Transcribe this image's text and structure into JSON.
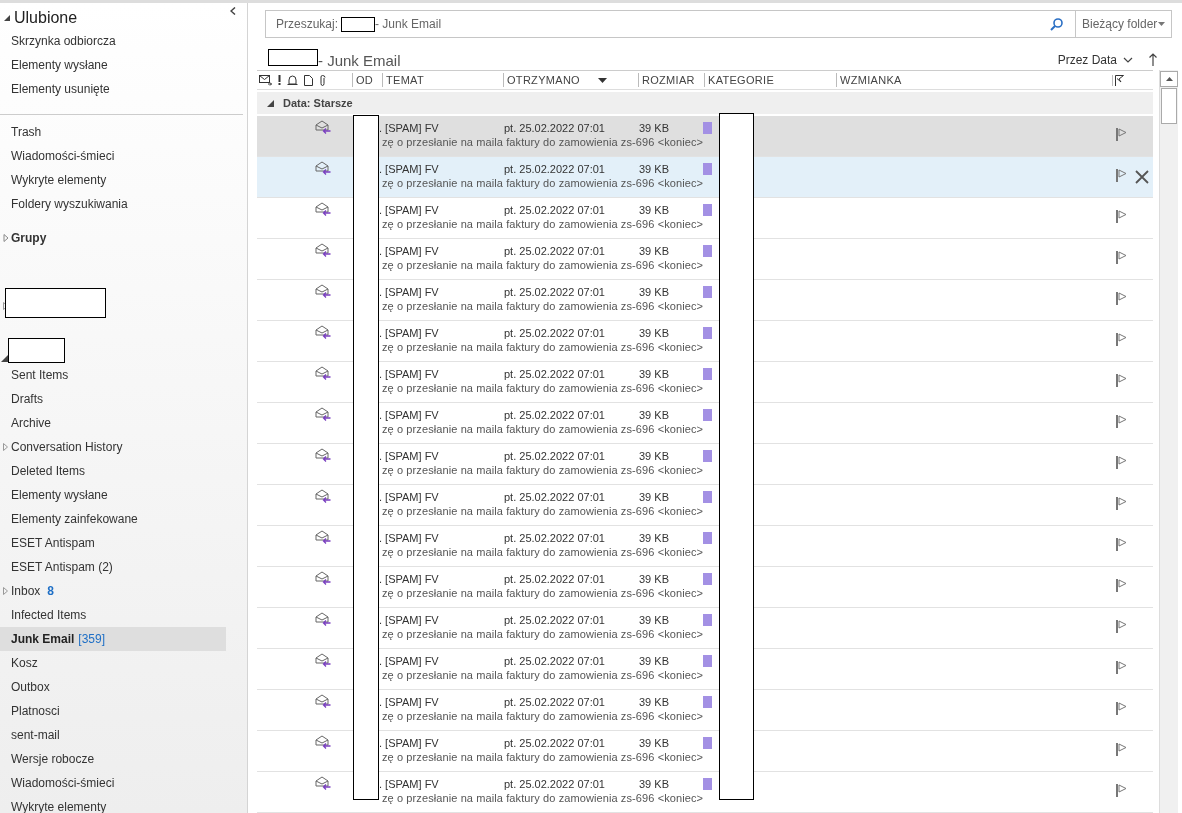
{
  "sidebar": {
    "favorites": {
      "title": "Ulubione",
      "expanded": true,
      "items": [
        {
          "label": "Skrzynka odbiorcza"
        },
        {
          "label": "Elementy wysłane"
        },
        {
          "label": "Elementy usunięte"
        }
      ]
    },
    "folders": [
      {
        "label": "Trash"
      },
      {
        "label": "Wiadomości-śmieci"
      },
      {
        "label": "Wykryte elementy"
      },
      {
        "label": "Foldery wyszukiwania"
      }
    ],
    "groups": {
      "label": "Grupy",
      "expanded": false
    },
    "accounts": [
      {
        "expanded": false
      },
      {
        "expanded": true,
        "folders": [
          {
            "label": "Sent Items",
            "selected": false
          },
          {
            "label": "Drafts",
            "selected": false
          },
          {
            "label": "Archive",
            "selected": false
          },
          {
            "label": "Conversation History",
            "selected": false,
            "expanded": false
          },
          {
            "label": "Deleted Items",
            "selected": false
          },
          {
            "label": "Elementy wysłane",
            "selected": false
          },
          {
            "label": "Elementy zainfekowane",
            "selected": false
          },
          {
            "label": "ESET Antispam",
            "selected": false
          },
          {
            "label": "ESET Antispam (2)",
            "selected": false
          },
          {
            "label": "Inbox",
            "selected": false,
            "expanded": false,
            "count": "8",
            "kind": "unread"
          },
          {
            "label": "Infected Items",
            "selected": false
          },
          {
            "label": "Junk Email",
            "selected": true,
            "count": "[359]",
            "kind": "total"
          },
          {
            "label": "Kosz",
            "selected": false
          },
          {
            "label": "Outbox",
            "selected": false
          },
          {
            "label": "Platnosci",
            "selected": false
          },
          {
            "label": "sent-mail",
            "selected": false
          },
          {
            "label": "Wersje robocze",
            "selected": false
          },
          {
            "label": "Wiadomości-śmieci",
            "selected": false
          },
          {
            "label": "Wykryte elementy",
            "selected": false
          }
        ]
      }
    ]
  },
  "search": {
    "prefix": "Przeszukaj:",
    "suffix": "- Junk Email",
    "scope": "Bieżący folder"
  },
  "folder_title": "- Junk Email",
  "sort": {
    "label": "Przez Data"
  },
  "columns": [
    "OD",
    "TEMAT",
    "OTRZYMANO",
    "ROZMIAR",
    "KATEGORIE",
    "WZMIANKA"
  ],
  "group": {
    "label": "Data: Starsze",
    "expanded": true
  },
  "messages": [
    {
      "subject": ". [SPAM] FV",
      "preview": "zę o przesłanie na maila faktury do zamowienia zs-696 <koniec>",
      "received": "pt. 25.02.2022 07:01",
      "size": "39 KB",
      "color": "#a390e4",
      "selected": true,
      "hover": false
    },
    {
      "subject": ". [SPAM] FV",
      "preview": "zę o przesłanie na maila faktury do zamowienia zs-696 <koniec>",
      "received": "pt. 25.02.2022 07:01",
      "size": "39 KB",
      "color": "#a390e4",
      "selected": false,
      "hover": true
    },
    {
      "subject": ". [SPAM] FV",
      "preview": "zę o przesłanie na maila faktury do zamowienia zs-696 <koniec>",
      "received": "pt. 25.02.2022 07:01",
      "size": "39 KB",
      "color": "#a390e4",
      "selected": false,
      "hover": false
    },
    {
      "subject": ". [SPAM] FV",
      "preview": "zę o przesłanie na maila faktury do zamowienia zs-696 <koniec>",
      "received": "pt. 25.02.2022 07:01",
      "size": "39 KB",
      "color": "#a390e4",
      "selected": false,
      "hover": false
    },
    {
      "subject": ". [SPAM] FV",
      "preview": "zę o przesłanie na maila faktury do zamowienia zs-696 <koniec>",
      "received": "pt. 25.02.2022 07:01",
      "size": "39 KB",
      "color": "#a390e4",
      "selected": false,
      "hover": false
    },
    {
      "subject": ". [SPAM] FV",
      "preview": "zę o przesłanie na maila faktury do zamowienia zs-696 <koniec>",
      "received": "pt. 25.02.2022 07:01",
      "size": "39 KB",
      "color": "#a390e4",
      "selected": false,
      "hover": false
    },
    {
      "subject": ". [SPAM] FV",
      "preview": "zę o przesłanie na maila faktury do zamowienia zs-696 <koniec>",
      "received": "pt. 25.02.2022 07:01",
      "size": "39 KB",
      "color": "#a390e4",
      "selected": false,
      "hover": false
    },
    {
      "subject": ". [SPAM] FV",
      "preview": "zę o przesłanie na maila faktury do zamowienia zs-696 <koniec>",
      "received": "pt. 25.02.2022 07:01",
      "size": "39 KB",
      "color": "#a390e4",
      "selected": false,
      "hover": false
    },
    {
      "subject": ". [SPAM] FV",
      "preview": "zę o przesłanie na maila faktury do zamowienia zs-696 <koniec>",
      "received": "pt. 25.02.2022 07:01",
      "size": "39 KB",
      "color": "#a390e4",
      "selected": false,
      "hover": false
    },
    {
      "subject": ". [SPAM] FV",
      "preview": "zę o przesłanie na maila faktury do zamowienia zs-696 <koniec>",
      "received": "pt. 25.02.2022 07:01",
      "size": "39 KB",
      "color": "#a390e4",
      "selected": false,
      "hover": false
    },
    {
      "subject": ". [SPAM] FV",
      "preview": "zę o przesłanie na maila faktury do zamowienia zs-696 <koniec>",
      "received": "pt. 25.02.2022 07:01",
      "size": "39 KB",
      "color": "#a390e4",
      "selected": false,
      "hover": false
    },
    {
      "subject": ". [SPAM] FV",
      "preview": "zę o przesłanie na maila faktury do zamowienia zs-696 <koniec>",
      "received": "pt. 25.02.2022 07:01",
      "size": "39 KB",
      "color": "#a390e4",
      "selected": false,
      "hover": false
    },
    {
      "subject": ". [SPAM] FV",
      "preview": "zę o przesłanie na maila faktury do zamowienia zs-696 <koniec>",
      "received": "pt. 25.02.2022 07:01",
      "size": "39 KB",
      "color": "#a390e4",
      "selected": false,
      "hover": false
    },
    {
      "subject": ". [SPAM] FV",
      "preview": "zę o przesłanie na maila faktury do zamowienia zs-696 <koniec>",
      "received": "pt. 25.02.2022 07:01",
      "size": "39 KB",
      "color": "#a390e4",
      "selected": false,
      "hover": false
    },
    {
      "subject": ". [SPAM] FV",
      "preview": "zę o przesłanie na maila faktury do zamowienia zs-696 <koniec>",
      "received": "pt. 25.02.2022 07:01",
      "size": "39 KB",
      "color": "#a390e4",
      "selected": false,
      "hover": false
    },
    {
      "subject": ". [SPAM] FV",
      "preview": "zę o przesłanie na maila faktury do zamowienia zs-696 <koniec>",
      "received": "pt. 25.02.2022 07:01",
      "size": "39 KB",
      "color": "#a390e4",
      "selected": false,
      "hover": false
    },
    {
      "subject": ". [SPAM] FV",
      "preview": "zę o przesłanie na maila faktury do zamowienia zs-696 <koniec>",
      "received": "pt. 25.02.2022 07:01",
      "size": "39 KB",
      "color": "#a390e4",
      "selected": false,
      "hover": false
    }
  ]
}
